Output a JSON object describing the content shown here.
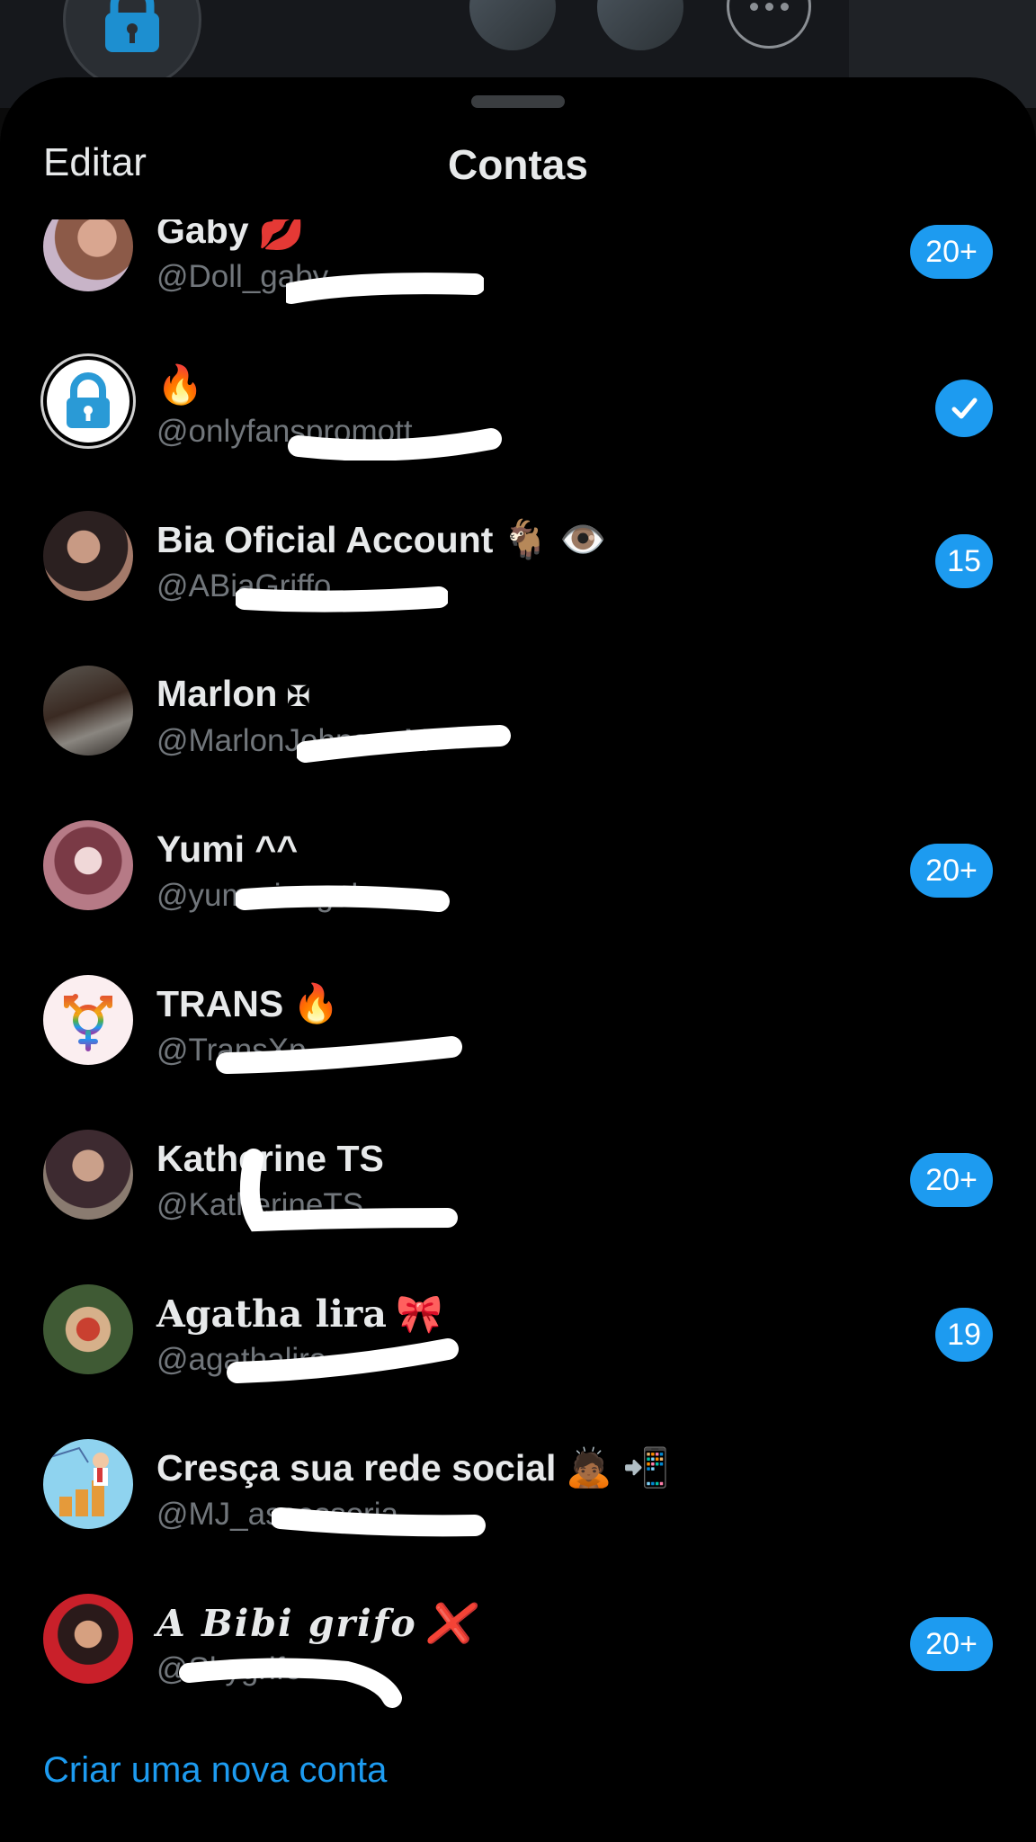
{
  "header": {
    "edit_label": "Editar",
    "title": "Contas"
  },
  "colors": {
    "accent": "#1d9bf0",
    "background": "#000000",
    "handle_gray": "#71767b",
    "text": "#e7e9ea"
  },
  "accounts": [
    {
      "name": "Gaby",
      "name_emoji": "💋",
      "handle": "@Doll_gaby",
      "badge": "20+",
      "avatar_icon": "photo-avatar"
    },
    {
      "name": "",
      "name_emoji": "🔥",
      "handle": "@onlyfanspromott",
      "selected": true,
      "avatar_icon": "lock-icon"
    },
    {
      "name": "Bia Oficial Account",
      "name_emoji": "🐐 👁️",
      "handle": "@ABiaGriffo",
      "badge": "15",
      "avatar_icon": "photo-avatar"
    },
    {
      "name": "Marlon",
      "name_emoji": "✠",
      "handle": "@MarlonJohnsonM",
      "avatar_icon": "photo-avatar"
    },
    {
      "name": "Yumi ^^",
      "name_emoji": "",
      "handle": "@yummiangel",
      "badge": "20+",
      "avatar_icon": "photo-avatar"
    },
    {
      "name": "TRANS",
      "name_emoji": "🔥",
      "handle": "@TransXp",
      "avatar_icon": "transgender-symbol-icon"
    },
    {
      "name": "Katherine TS",
      "name_emoji": "",
      "handle": "@KatherineTS",
      "badge": "20+",
      "avatar_icon": "photo-avatar"
    },
    {
      "name": "Agatha lira",
      "name_emoji": "🎀",
      "handle": "@agathalira",
      "badge": "19",
      "avatar_icon": "photo-avatar"
    },
    {
      "name": "Cresça sua rede social",
      "name_emoji": "🙇🏾 📲",
      "handle": "@MJ_assessoria",
      "avatar_icon": "illustration-avatar"
    },
    {
      "name": "A Bibi grifo",
      "name_emoji": "❌",
      "handle": "@Skygrifo",
      "badge": "20+",
      "avatar_icon": "photo-avatar"
    }
  ],
  "footer": {
    "create_label": "Criar uma nova conta"
  }
}
